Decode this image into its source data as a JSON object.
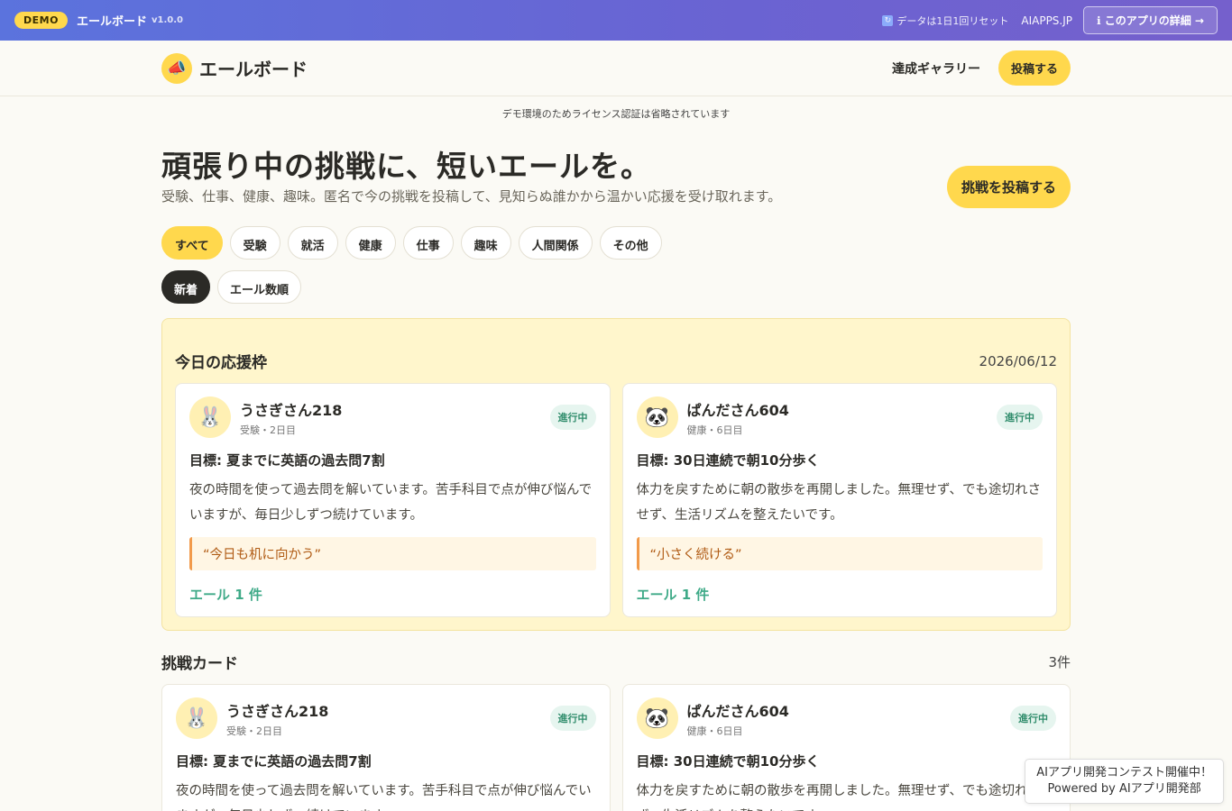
{
  "demobar": {
    "badge": "DEMO",
    "title": "エールボード",
    "version": "v1.0.0",
    "reset_note": "データは1日1回リセット",
    "aiapps": "AIAPPS.JP",
    "details_button": "ℹ このアプリの詳細 →"
  },
  "header": {
    "logo_icon": "📣",
    "logo_text": "エールボード",
    "gallery_link": "達成ギャラリー",
    "post_button": "投稿する"
  },
  "license_note": "デモ環境のためライセンス認証は省略されています",
  "hero": {
    "title": "頑張り中の挑戦に、短いエールを。",
    "subtitle": "受験、仕事、健康、趣味。匿名で今の挑戦を投稿して、見知らぬ誰かから温かい応援を受け取れます。",
    "cta": "挑戦を投稿する"
  },
  "categories": [
    "すべて",
    "受験",
    "就活",
    "健康",
    "仕事",
    "趣味",
    "人間関係",
    "その他"
  ],
  "sorts": [
    "新着",
    "エール数順"
  ],
  "today": {
    "title": "今日の応援枠",
    "date": "2026/06/12",
    "cards": [
      {
        "avatar": "🐰",
        "name": "うさぎさん218",
        "meta": "受験・2日目",
        "status": "進行中",
        "goal": "目標: 夏までに英語の過去問7割",
        "body": "夜の時間を使って過去問を解いています。苦手科目で点が伸び悩んでいますが、毎日少しずつ続けています。",
        "quote": "“今日も机に向かう”",
        "ale": "エール 1 件"
      },
      {
        "avatar": "🐼",
        "name": "ぱんださん604",
        "meta": "健康・6日目",
        "status": "進行中",
        "goal": "目標: 30日連続で朝10分歩く",
        "body": "体力を戻すために朝の散歩を再開しました。無理せず、でも途切れさせず、生活リズムを整えたいです。",
        "quote": "“小さく続ける”",
        "ale": "エール 1 件"
      }
    ]
  },
  "challenges": {
    "title": "挑戦カード",
    "count": "3件",
    "cards": [
      {
        "avatar": "🐰",
        "name": "うさぎさん218",
        "meta": "受験・2日目",
        "status": "進行中",
        "goal": "目標: 夏までに英語の過去問7割",
        "body": "夜の時間を使って過去問を解いています。苦手科目で点が伸び悩んでいますが、毎日少しずつ続けています。"
      },
      {
        "avatar": "🐼",
        "name": "ぱんださん604",
        "meta": "健康・6日目",
        "status": "進行中",
        "goal": "目標: 30日連続で朝10分歩く",
        "body": "体力を戻すために朝の散歩を再開しました。無理せず、でも途切れさせず、生活リズムを整えたいです。"
      }
    ]
  },
  "contest_banner": {
    "line1": "AIアプリ開発コンテスト開催中！",
    "line2": "Powered by AIアプリ開発部"
  }
}
